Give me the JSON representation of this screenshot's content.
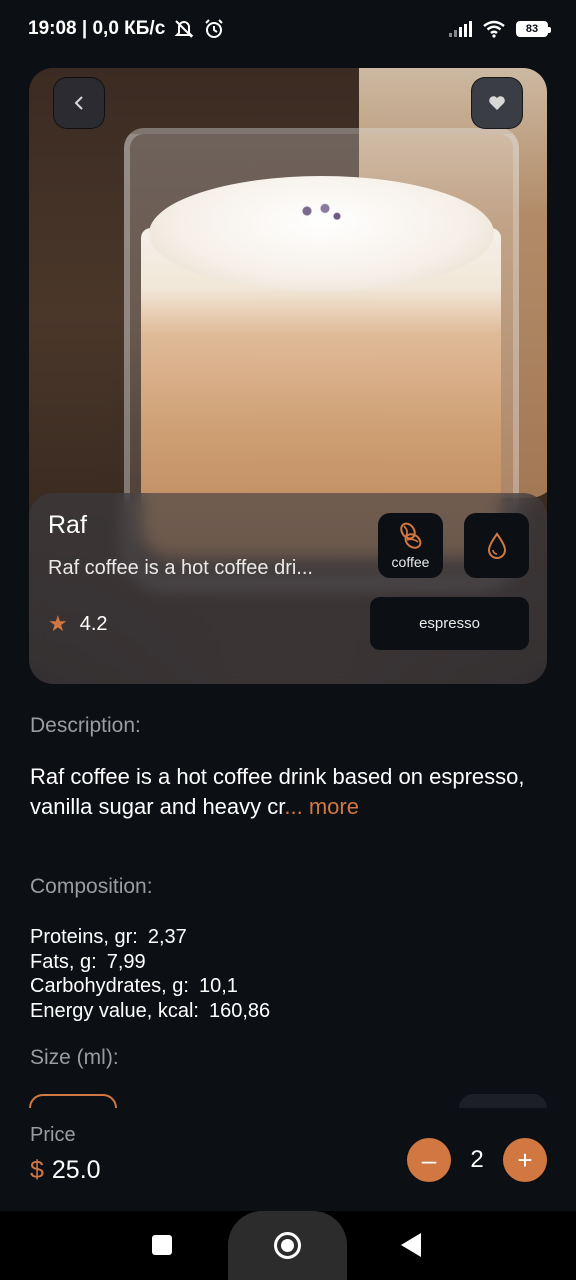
{
  "status_bar": {
    "time_network": "19:08 | 0,0 КБ/с",
    "battery": "83",
    "icons": [
      "muted-icon",
      "alarm-icon",
      "signal-icon",
      "wifi-icon",
      "battery-icon"
    ]
  },
  "hero": {
    "back_icon": "back-chevron-icon",
    "favorite_icon": "heart-icon"
  },
  "product": {
    "name": "Raf",
    "short_description": "Raf coffee is a hot coffee dri...",
    "rating": "4.2",
    "tags": [
      {
        "label": "coffee",
        "icon": "coffee-beans-icon"
      },
      {
        "label": "",
        "icon": "milk-drop-icon"
      }
    ],
    "roast": "espresso"
  },
  "description": {
    "title": "Description:",
    "text": "Raf coffee is a hot coffee drink based on espresso, vanilla sugar and heavy cr",
    "more_label": "... more"
  },
  "composition": {
    "title": "Composition:",
    "items": [
      {
        "label": "Proteins, gr:",
        "value": "2,37"
      },
      {
        "label": "Fats, g:",
        "value": "7,99"
      },
      {
        "label": "Carbohydrates, g:",
        "value": "10,1"
      },
      {
        "label": "Energy value, kcal:",
        "value": "160,86"
      }
    ]
  },
  "size": {
    "title": "Size (ml):"
  },
  "footer": {
    "price_label": "Price",
    "currency": "$",
    "price": "25.0",
    "quantity": "2",
    "minus_label": "–",
    "plus_label": "+"
  },
  "colors": {
    "accent": "#d17842",
    "background": "#0c0f14",
    "muted_text": "#9a9ca0"
  }
}
